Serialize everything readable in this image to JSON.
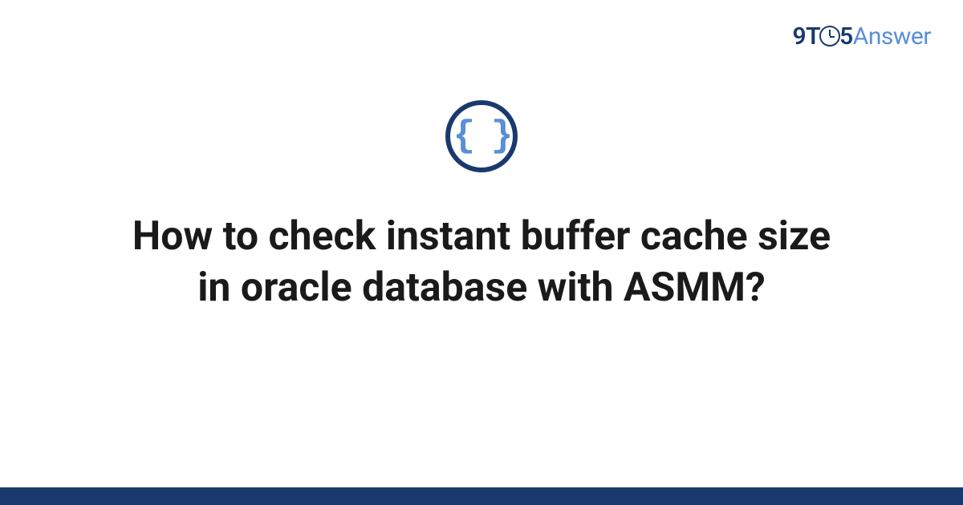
{
  "logo": {
    "part1": "9",
    "part2": "T",
    "part3": "5",
    "part4": "Answer"
  },
  "icon": {
    "name": "code-braces-icon",
    "glyph": "{ }"
  },
  "title": "How to check instant buffer cache size in oracle database with ASMM?",
  "colors": {
    "brand_dark": "#1a3a6e",
    "brand_light": "#5a8fd6",
    "text": "#1a1a1a"
  }
}
